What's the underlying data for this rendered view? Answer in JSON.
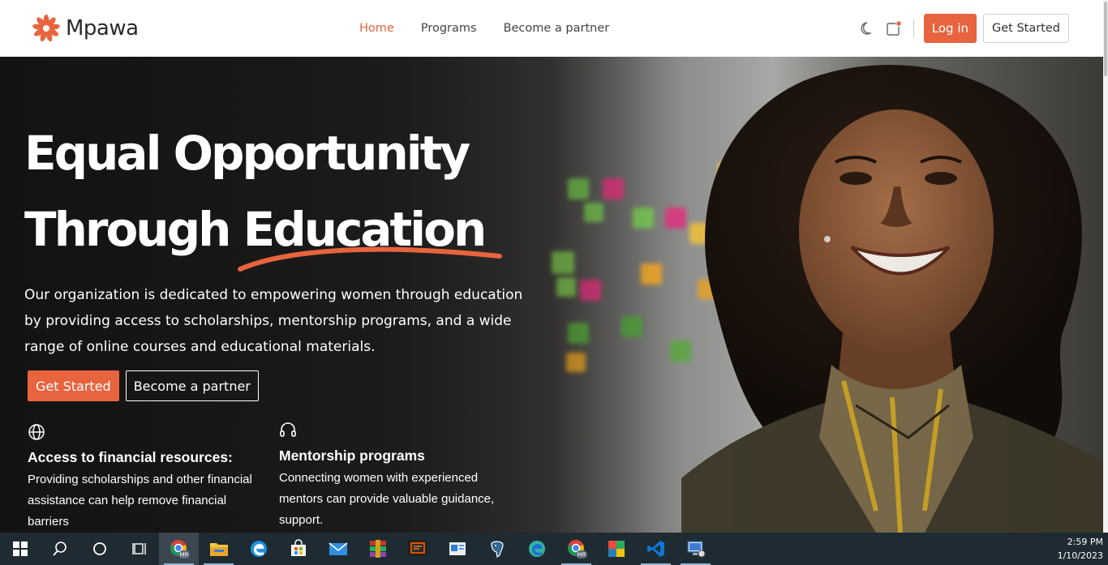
{
  "brand": {
    "name": "Mpawa",
    "accent": "#e7643f"
  },
  "nav": {
    "items": [
      {
        "label": "Home",
        "active": true
      },
      {
        "label": "Programs",
        "active": false
      },
      {
        "label": "Become a partner",
        "active": false
      }
    ]
  },
  "header_actions": {
    "theme_icon": "moon-icon",
    "notification_icon": "notification-icon",
    "login_label": "Log in",
    "get_started_label": "Get Started"
  },
  "hero": {
    "headline_line1": "Equal Opportunity",
    "headline_line2": "Through Education",
    "intro_line1": "Our organization is dedicated to empowering women through education",
    "intro_line2": "by providing access to scholarships, mentorship programs, and a wide",
    "intro_line3": "range of online courses and educational materials.",
    "cta_primary": "Get Started",
    "cta_secondary": "Become a partner"
  },
  "features": [
    {
      "icon": "globe-icon",
      "title": "Access to financial resources:",
      "desc_line1": "Providing scholarships and other financial",
      "desc_line2": "assistance can help remove financial",
      "desc_line3": "barriers"
    },
    {
      "icon": "headset-icon",
      "title": "Mentorship programs",
      "desc_line1": "Connecting women with experienced",
      "desc_line2": "mentors can provide valuable guidance,",
      "desc_line3": "support."
    }
  ],
  "taskbar": {
    "apps": [
      "windows-start-icon",
      "search-icon",
      "cortana-icon",
      "task-view-icon",
      "chrome-icon",
      "file-explorer-icon",
      "edge-icon",
      "store-icon",
      "mail-icon",
      "winrar-icon",
      "presentation-icon",
      "outlook-icon",
      "postgres-icon",
      "edge-beta-icon",
      "chrome-icon",
      "office-icon",
      "vscode-icon",
      "remote-desktop-icon"
    ],
    "chrome_badge": "MR",
    "time": "2:59 PM",
    "date": "1/10/2023"
  }
}
